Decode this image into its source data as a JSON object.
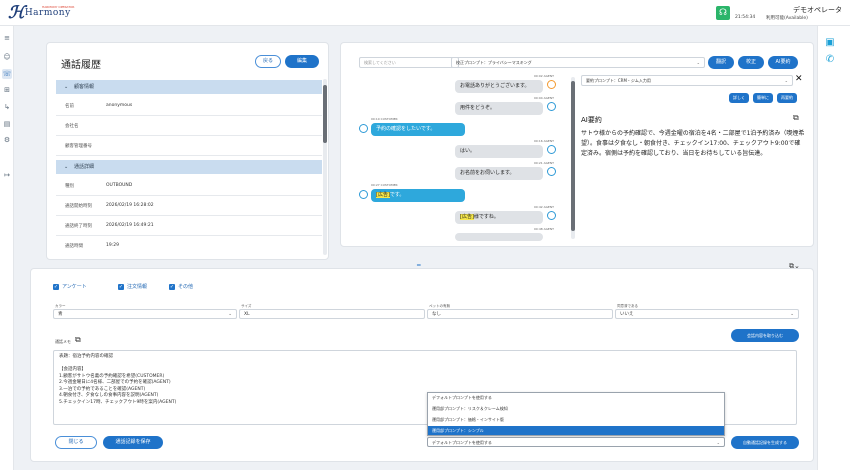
{
  "app": {
    "brand_mark": "ℋ",
    "brand_name": "Harmony",
    "brand_tagline": "HARMONY OPERATOR"
  },
  "header": {
    "clock": "21:54:34",
    "status": "利用可能(Available)",
    "operator": "デモオペレータ",
    "colors": {
      "headset_bg": "#2bb56a"
    }
  },
  "history": {
    "title": "通話履歴",
    "back_label": "戻る",
    "edit_label": "編集",
    "customer_section": "顧客情報",
    "customer_rows": [
      {
        "label": "名前",
        "value": "anonymous"
      },
      {
        "label": "会社名",
        "value": ""
      },
      {
        "label": "顧客管理番号",
        "value": ""
      }
    ],
    "call_section": "通話詳細",
    "call_rows": [
      {
        "label": "種別",
        "value": "OUTBOUND"
      },
      {
        "label": "通話開始時刻",
        "value": "2026/02/19 16:28:02"
      },
      {
        "label": "通話終了時刻",
        "value": "2026/02/19 16:49:21"
      },
      {
        "label": "通話時間",
        "value": "19:29"
      }
    ]
  },
  "transcript": {
    "search_placeholder": "検索してください",
    "prompt": "校正プロンプト：プライバシーマスキング",
    "buttons": [
      "翻訳",
      "校正",
      "AI要約"
    ],
    "messages": [
      {
        "meta": "00:02 AGENT",
        "text": "お電話ありがとうございます。",
        "role": "agent"
      },
      {
        "meta": "00:04 AGENT",
        "text": "用件をどうぞ。",
        "role": "agent"
      },
      {
        "meta": "00:10 CUSTOMER",
        "text": "予約の確認をしたいです。",
        "role": "customer"
      },
      {
        "meta": "00:16 AGENT",
        "text": "はい。",
        "role": "agent"
      },
      {
        "meta": "00:21 AGENT",
        "text": "お名前をお伺いします。",
        "role": "agent"
      },
      {
        "meta": "00:27 CUSTOMER",
        "text_hl": "[広告]",
        "text": "です。",
        "role": "customer"
      },
      {
        "meta": "00:42 AGENT",
        "text_hl": "[広告]",
        "text": "様ですね。",
        "role": "agent"
      }
    ]
  },
  "summary": {
    "prompt": "要約プロンプト：CRM・ジム入力用",
    "buttons": [
      "詳しく",
      "簡単に",
      "再要約"
    ],
    "title": "AI要約",
    "text": "サトウ様からの予約確認で、今週金曜の宿泊を4名・二部屋で1泊予約済み（喫煙希望）。食事は夕食なし・朝食付き、チェックイン17:00、チェックアウト9:00で確定済み。宿側は予約を確認しており、当日をお待ちしている旨伝達。"
  },
  "bottom": {
    "tabs": [
      "アンケート",
      "注文情報",
      "その他"
    ],
    "fields": [
      {
        "label": "カラー",
        "value": "青"
      },
      {
        "label": "サイズ",
        "value": "XL"
      },
      {
        "label": "ペットの有無",
        "value": "なし"
      },
      {
        "label": "同意済である",
        "value": "いいえ"
      }
    ],
    "apply_button": "会話内容を取り込む",
    "memo_label": "通話メモ",
    "memo": "表題：宿泊予約内容の確認\n\n【会話内容】\n1.顧客がサトウ名義の予約確認を希望(CUSTOMER)\n2.今週金曜日に4名様、二部屋での予約を確認(AGENT)\n3.一泊での予約であることを確認(AGENT)\n4.朝食付き、夕食なしの食事内容を説明(AGENT)\n5.チェックイン17時、チェックアウト9時を案内(AGENT)",
    "dropdown_options": [
      "デフォルトプロンプトを使用する",
      "運用部プロンプト：リスク＆クレーム検知",
      "運用部プロンプト：価格・インサイト版",
      "運用部プロンプト：シンプル"
    ],
    "dropdown_selected_index": 3,
    "dropdown_value": "デフォルトプロンプトを使用する",
    "close_label": "閉じる",
    "save_label": "通話記録を保存",
    "generate_label": "自動通話記録を生成する"
  }
}
